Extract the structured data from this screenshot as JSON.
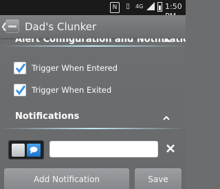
{
  "status_bar": {
    "nfc_label": "N",
    "network_label": "4G",
    "time": "1:50 PM"
  },
  "action_bar": {
    "back_icon": "chevron-left-icon",
    "app_icon": "app-icon",
    "title": "Dad's Clunker"
  },
  "alert_section": {
    "title": "Alert Configuration and Notifications",
    "expanded": true,
    "items": [
      {
        "label": "Trigger When Entered",
        "checked": true
      },
      {
        "label": "Trigger When Exited",
        "checked": true
      }
    ]
  },
  "notifications_section": {
    "title": "Notifications",
    "expanded": true,
    "rows": [
      {
        "type_icon": "chat-bubble-icon",
        "value": "",
        "remove_icon": "close-icon"
      }
    ]
  },
  "buttons": {
    "add_notification": "Add Notification",
    "save": "Save"
  },
  "colors": {
    "background": "#6b6d6f",
    "accent_blue": "#3a93e6",
    "glow": "#c8f0ff"
  }
}
